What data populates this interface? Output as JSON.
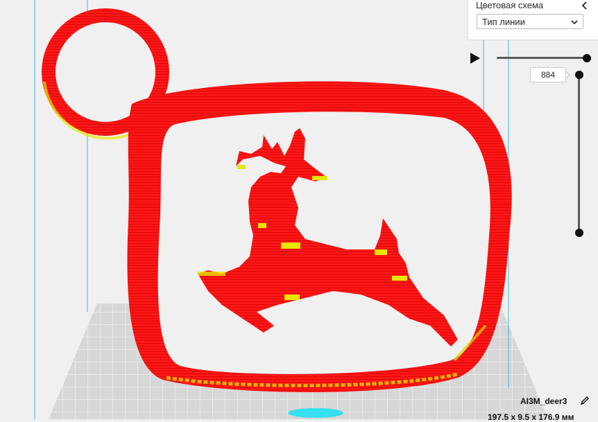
{
  "panel": {
    "title": "Цветовая схема",
    "collapse_icon": "chevron-left-icon",
    "select": {
      "value": "Тип линии",
      "icon": "chevron-down-icon"
    }
  },
  "layer_slider": {
    "play_icon": "play-icon",
    "current_layer": "884"
  },
  "object": {
    "name": "AI3M_deer3",
    "edit_icon": "pencil-icon",
    "dimensions": "197.5 x 9.5 x 176.9 мм"
  },
  "colors": {
    "background": "#f0f0f0",
    "build_plate": "#d9d9d9",
    "grid_line": "#ffffff",
    "model_wall": "#ff1a1a",
    "model_infill": "#e6e600",
    "volume_edge": "#41b6d8",
    "base_cyan": "#36e0ee"
  }
}
